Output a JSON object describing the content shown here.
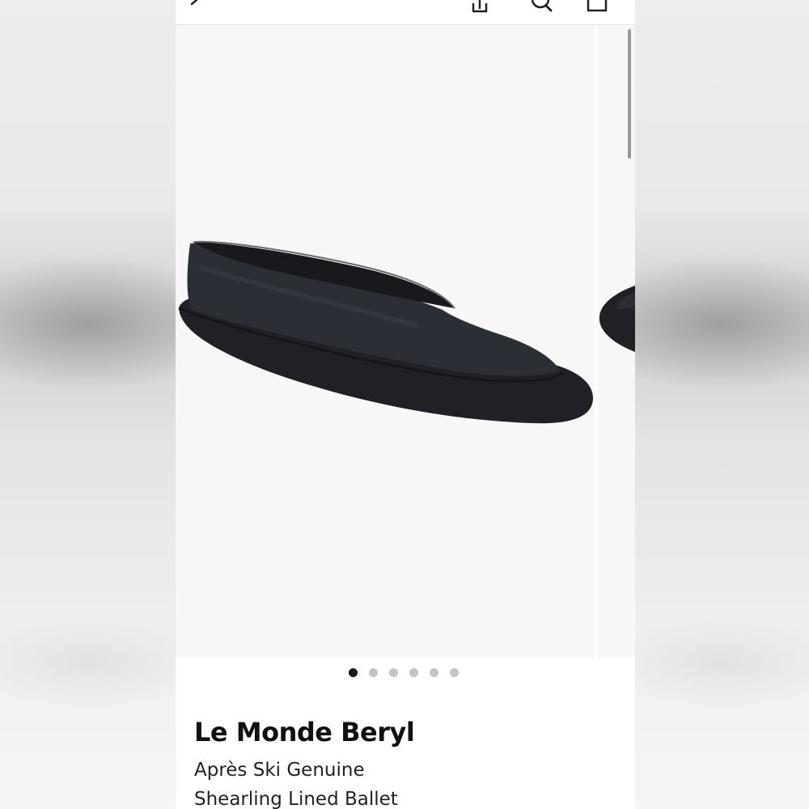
{
  "header": {
    "icons": [
      "back-chevron-icon",
      "share-icon",
      "search-icon",
      "bag-icon"
    ]
  },
  "gallery": {
    "image": "black suede shearling-lined ballet flat",
    "slide_count": 6,
    "active_index": 0
  },
  "product": {
    "brand": "Le Monde Beryl",
    "name_lines": [
      "Après Ski Genuine",
      "Shearling Lined Ballet"
    ]
  },
  "colors": {
    "accent_dark": "#111111",
    "dot_inactive": "#c4c4c4",
    "image_bg": "#f7f7f7"
  }
}
